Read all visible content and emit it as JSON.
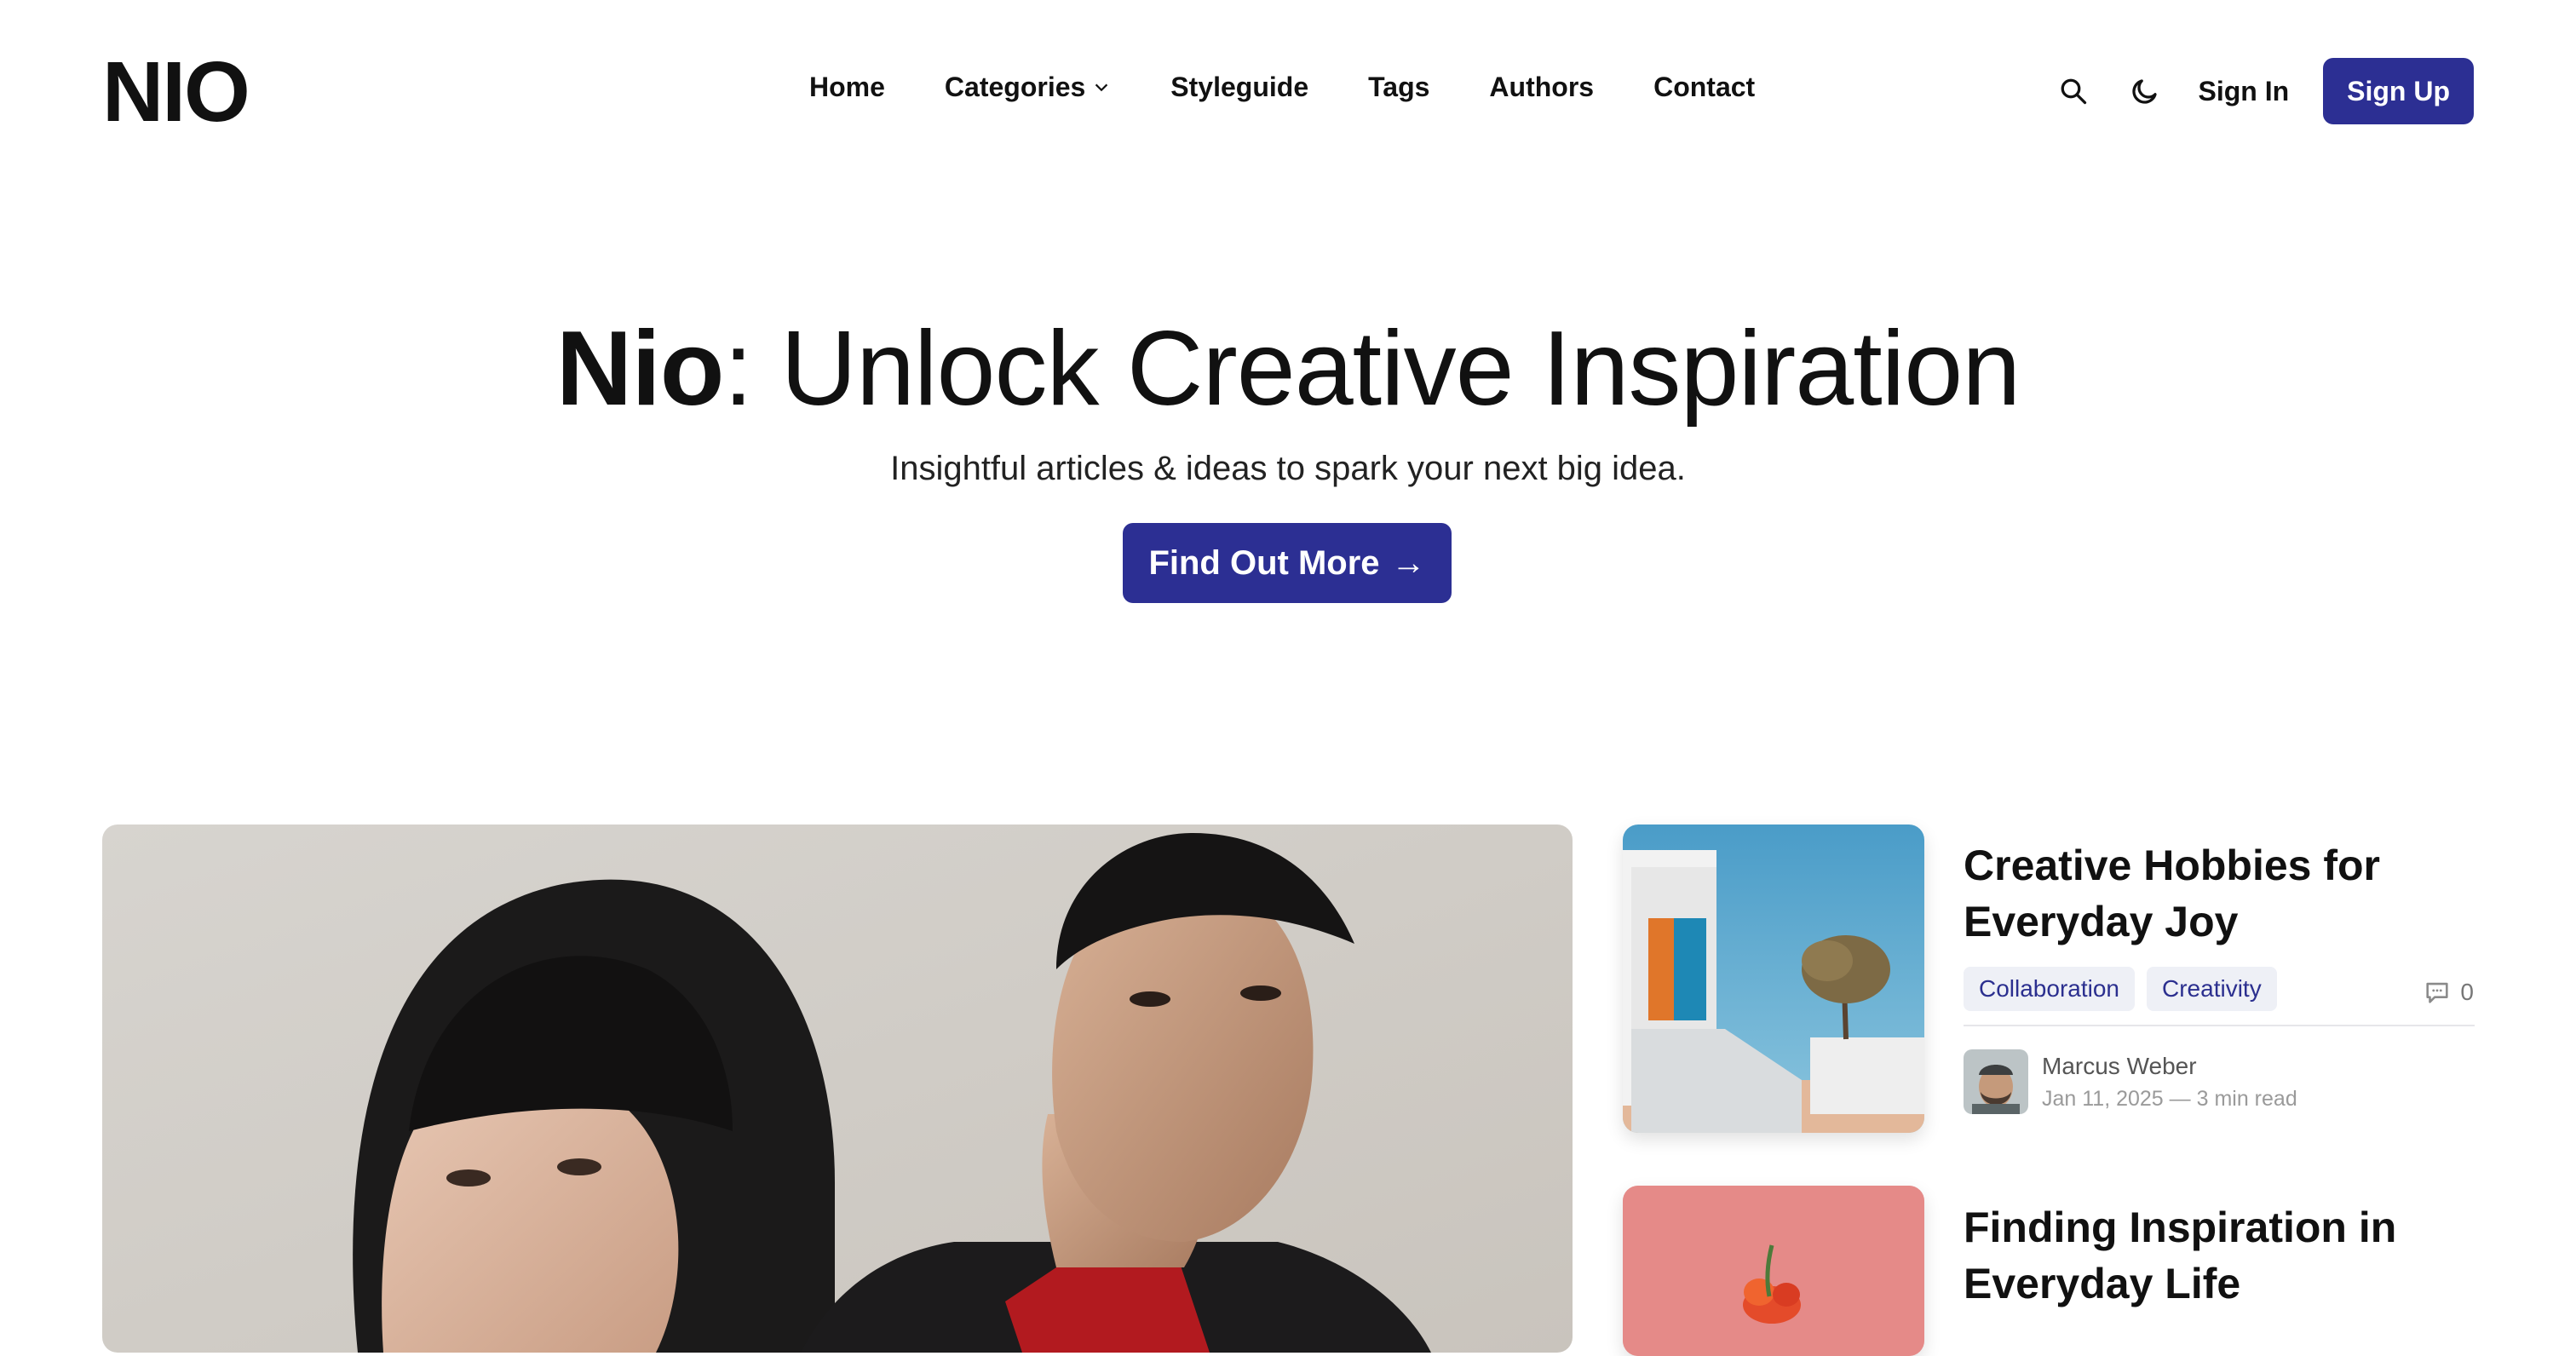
{
  "header": {
    "logo": "NIO",
    "nav": [
      {
        "label": "Home"
      },
      {
        "label": "Categories"
      },
      {
        "label": "Styleguide"
      },
      {
        "label": "Tags"
      },
      {
        "label": "Authors"
      },
      {
        "label": "Contact"
      }
    ],
    "signin_label": "Sign In",
    "signup_label": "Sign Up"
  },
  "hero": {
    "title_bold": "Nio",
    "title_rest": ": Unlock Creative Inspiration",
    "subtitle": "Insightful articles & ideas to spark your next big idea.",
    "cta_label": "Find Out More",
    "cta_arrow": "→"
  },
  "posts": [
    {
      "title": "Creative Hobbies for Everyday Joy",
      "tags": [
        "Collaboration",
        "Creativity"
      ],
      "comments": "0",
      "author": "Marcus Weber",
      "meta": "Jan 11, 2025 — 3 min read"
    },
    {
      "title": "Finding Inspiration in Everyday Life"
    }
  ],
  "colors": {
    "brand": "#2c2f93",
    "tag_bg": "#eef0f6",
    "tag_text": "#2b2f8f"
  }
}
